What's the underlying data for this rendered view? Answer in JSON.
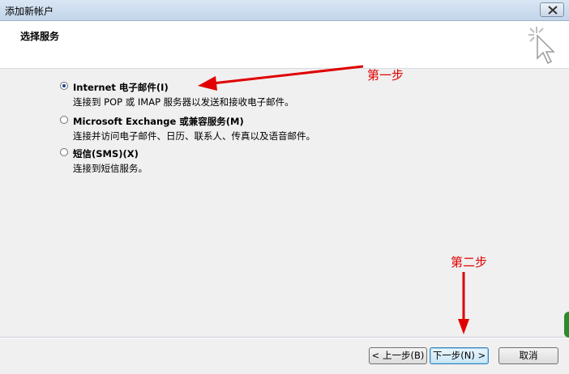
{
  "window": {
    "title": "添加新帐户",
    "close_icon": "close-icon"
  },
  "header": {
    "title": "选择服务",
    "graphic_icon": "cursor-sparkle-icon"
  },
  "options": [
    {
      "label": "Internet 电子邮件(I)",
      "description": "连接到 POP 或 IMAP 服务器以发送和接收电子邮件。",
      "selected": true
    },
    {
      "label": "Microsoft Exchange 或兼容服务(M)",
      "description": "连接并访问电子邮件、日历、联系人、传真以及语音邮件。",
      "selected": false
    },
    {
      "label": "短信(SMS)(X)",
      "description": "连接到短信服务。",
      "selected": false
    }
  ],
  "buttons": {
    "back": "< 上一步(B)",
    "next": "下一步(N) >",
    "cancel": "取消"
  },
  "annotations": {
    "step1": "第一步",
    "step2": "第二步",
    "color": "#e00000"
  }
}
